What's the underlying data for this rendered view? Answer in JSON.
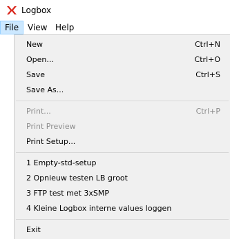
{
  "window": {
    "title": "Logbox",
    "icon": "logbox-app-icon"
  },
  "menubar": {
    "items": [
      "File",
      "View",
      "Help"
    ],
    "active": "File"
  },
  "file_menu": {
    "groups": [
      [
        {
          "label": "New",
          "shortcut": "Ctrl+N",
          "enabled": true
        },
        {
          "label": "Open...",
          "shortcut": "Ctrl+O",
          "enabled": true
        },
        {
          "label": "Save",
          "shortcut": "Ctrl+S",
          "enabled": true
        },
        {
          "label": "Save As...",
          "shortcut": "",
          "enabled": true
        }
      ],
      [
        {
          "label": "Print...",
          "shortcut": "Ctrl+P",
          "enabled": false
        },
        {
          "label": "Print Preview",
          "shortcut": "",
          "enabled": false
        },
        {
          "label": "Print Setup...",
          "shortcut": "",
          "enabled": true
        }
      ],
      [
        {
          "label": "1 Empty-std-setup",
          "shortcut": "",
          "enabled": true
        },
        {
          "label": "2 Opnieuw testen LB groot",
          "shortcut": "",
          "enabled": true
        },
        {
          "label": "3 FTP test met 3xSMP",
          "shortcut": "",
          "enabled": true
        },
        {
          "label": "4 Kleine Logbox interne values loggen",
          "shortcut": "",
          "enabled": true
        }
      ],
      [
        {
          "label": "Exit",
          "shortcut": "",
          "enabled": true
        }
      ]
    ]
  },
  "colors": {
    "menu_bg": "#f0f0f0",
    "active_menu_bg": "#cce8ff",
    "disabled_text": "#8c8c8c",
    "icon_red": "#d9261c"
  }
}
